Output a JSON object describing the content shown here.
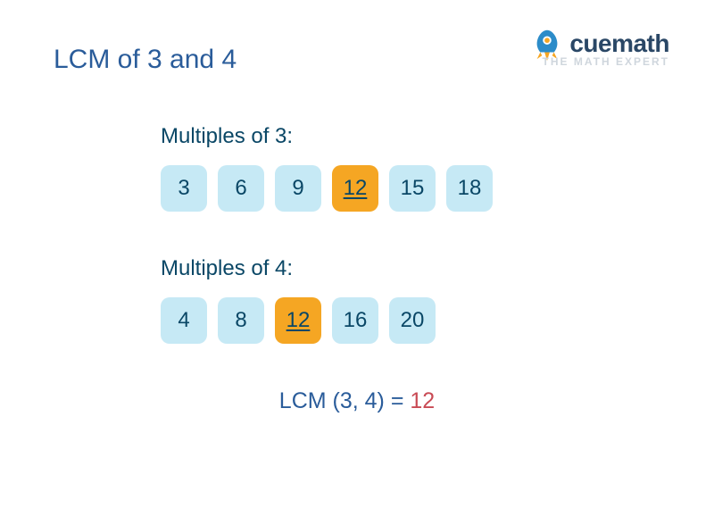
{
  "title": "LCM of 3 and 4",
  "logo": {
    "text": "cuemath",
    "sub": "THE MATH EXPERT"
  },
  "section1": {
    "label": "Multiples of 3:",
    "chips": [
      {
        "value": "3",
        "highlight": false
      },
      {
        "value": "6",
        "highlight": false
      },
      {
        "value": "9",
        "highlight": false
      },
      {
        "value": "12",
        "highlight": true
      },
      {
        "value": "15",
        "highlight": false
      },
      {
        "value": "18",
        "highlight": false
      }
    ]
  },
  "section2": {
    "label": "Multiples of 4:",
    "chips": [
      {
        "value": "4",
        "highlight": false
      },
      {
        "value": "8",
        "highlight": false
      },
      {
        "value": "12",
        "highlight": true
      },
      {
        "value": "16",
        "highlight": false
      },
      {
        "value": "20",
        "highlight": false
      }
    ]
  },
  "result": {
    "prefix": "LCM (3, 4) = ",
    "answer": "12"
  }
}
